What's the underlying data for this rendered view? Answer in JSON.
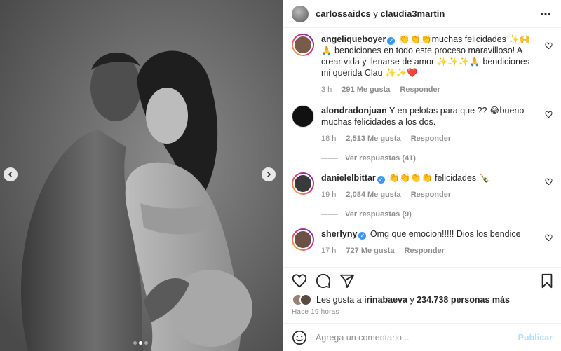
{
  "post": {
    "author": "carlossaidcs",
    "connector": "y",
    "coauthor": "claudia3martin"
  },
  "comments": [
    {
      "username": "angeliqueboyer",
      "verified": true,
      "text": "👏👏👏muchas felicidades ✨🙌🙏 bendiciones en todo este proceso maravilloso! A crear vida y llenarse de amor ✨✨✨🙏 bendiciones mi querida Clau ✨✨❤️",
      "time": "3 h",
      "likes": "291 Me gusta",
      "reply": "Responder"
    },
    {
      "username": "alondradonjuan",
      "verified": false,
      "text": "Y en pelotas para que ?? 😂bueno muchas felicidades a los dos.",
      "time": "18 h",
      "likes": "2,513 Me gusta",
      "reply": "Responder",
      "replies": "Ver respuestas (41)"
    },
    {
      "username": "danielelbittar",
      "verified": true,
      "text": "👏👏👏👏 felicidades 🍾",
      "time": "19 h",
      "likes": "2,084 Me gusta",
      "reply": "Responder",
      "replies": "Ver respuestas (9)"
    },
    {
      "username": "sherlyny",
      "verified": true,
      "text": "Omg que emocion!!!!! Dios los bendice",
      "time": "17 h",
      "likes": "727 Me gusta",
      "reply": "Responder"
    }
  ],
  "likes": {
    "prefix": "Les gusta a",
    "user": "irinabaeva",
    "middle": "y",
    "count": "234.738 personas más"
  },
  "posted_ago": "Hace 19 horas",
  "add_comment": {
    "placeholder": "Agrega un comentario...",
    "publish": "Publicar"
  },
  "icons": {
    "more": "more-dots-icon",
    "like": "heart-icon",
    "comment": "comment-bubble-icon",
    "share": "paper-plane-icon",
    "save": "bookmark-icon",
    "emoji": "smiley-icon",
    "prev": "chevron-left-icon",
    "next": "chevron-right-icon"
  },
  "carousel": {
    "total": 3,
    "active": 2
  },
  "colors": {
    "verified": "#3897f0",
    "secondary_text": "#8e8e8e",
    "publish": "#b2dffc"
  }
}
